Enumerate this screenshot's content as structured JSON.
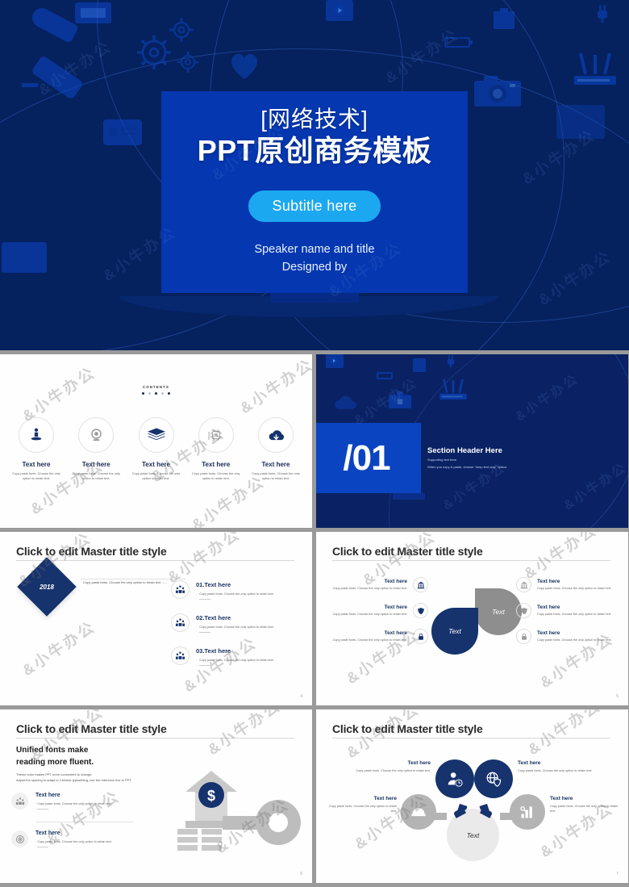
{
  "meta": {
    "watermark": "&小牛办公"
  },
  "colors": {
    "navy_dark": "#05215E",
    "blue_bright": "#0437B0",
    "accent_cyan": "#1CA8F0",
    "navy_text": "#17336E",
    "gray": "#8E8E8E"
  },
  "slides": [
    {
      "id": "title-slide",
      "pre_title": "[网络技术]",
      "title": "PPT原创商务模板",
      "subtitle_button": "Subtitle here",
      "speaker": "Speaker name and title",
      "designer": "Designed by"
    },
    {
      "id": "contents-slide",
      "label": "CONTENTS",
      "dots": 5,
      "items": [
        {
          "icon": "presenter-icon",
          "heading": "Text here",
          "body": "Copy paste fonts. Choose the only option to retain text.",
          "tone": "navy"
        },
        {
          "icon": "webcam-icon",
          "heading": "Text here",
          "body": "Copy paste fonts. Choose the only option to retain text.",
          "tone": "gray"
        },
        {
          "icon": "layers-icon",
          "heading": "Text here",
          "body": "Copy paste fonts. Choose the only option to retain text.",
          "tone": "navy"
        },
        {
          "icon": "chip-icon",
          "heading": "Text here",
          "body": "Copy paste fonts. Choose the only option to retain text.",
          "tone": "gray"
        },
        {
          "icon": "cloud-download-icon",
          "heading": "Text here",
          "body": "Copy paste fonts. Choose the only option to retain text.",
          "tone": "navy"
        }
      ]
    },
    {
      "id": "section-header-slide",
      "number": "/01",
      "heading": "Section Header Here",
      "sub1": "Supporting text here.",
      "sub2": "When you copy & paste, choose \"keep text only\" option."
    },
    {
      "id": "timeline-slide",
      "title": "Click to edit Master title style",
      "year": "2018",
      "note": "Copy paste fonts. Choose the only option to retain text……",
      "page": "4",
      "steps": [
        {
          "icon": "team-icon",
          "heading": "01.Text here",
          "body": "Copy paste fonts. Choose the only option to retain text."
        },
        {
          "icon": "team-icon",
          "heading": "02.Text here",
          "body": "Copy paste fonts. Choose the only option to retain text."
        },
        {
          "icon": "team-icon",
          "heading": "03.Text here",
          "body": "Copy paste fonts. Choose the only option to retain text."
        }
      ]
    },
    {
      "id": "leaf-diagram-slide",
      "title": "Click to edit Master title style",
      "page": "5",
      "center_navy": "Text",
      "center_gray": "Text",
      "left_items": [
        {
          "icon": "bank-icon",
          "heading": "Text here",
          "body": "Copy paste fonts. Choose the only option to retain text."
        },
        {
          "icon": "shield-icon",
          "heading": "Text here",
          "body": "Copy paste fonts. Choose the only option to retain text."
        },
        {
          "icon": "lock-icon",
          "heading": "Text here",
          "body": "Copy paste fonts. Choose the only option to retain text."
        }
      ],
      "right_items": [
        {
          "icon": "bank-icon",
          "heading": "Text here",
          "body": "Copy paste fonts. Choose the only option to retain text."
        },
        {
          "icon": "shield-icon",
          "heading": "Text here",
          "body": "Copy paste fonts. Choose the only option to retain text."
        },
        {
          "icon": "lock-icon",
          "heading": "Text here",
          "body": "Copy paste fonts. Choose the only option to retain text."
        }
      ]
    },
    {
      "id": "fonts-slide",
      "title": "Click to edit Master title style",
      "page": "6",
      "heading_line1": "Unified fonts make",
      "heading_line2": "reading more fluent.",
      "para1": "Theme color makes PPT more convenient to change.",
      "para2": "Adjust the spacing to adapt to Chinese typesetting, use the reference line in PPT.",
      "items": [
        {
          "icon": "team-icon",
          "heading": "Text here",
          "body": "Copy paste fonts. Choose the only option to retain text."
        },
        {
          "icon": "target-icon",
          "heading": "Text here",
          "body": "Copy paste fonts. Choose the only option to retain text."
        }
      ],
      "illustration": "house-key-dollar-icon"
    },
    {
      "id": "bubble-diagram-slide",
      "title": "Click to edit Master title style",
      "page": "7",
      "center": "Text",
      "bubbles": [
        {
          "icon": "user-clock-icon",
          "heading": "Text here",
          "body": "Copy paste fonts. Choose the only option to retain text.",
          "tone": "navy",
          "pos": "top-left"
        },
        {
          "icon": "globe-shield-icon",
          "heading": "Text here",
          "body": "Copy paste fonts. Choose the only option to retain text.",
          "tone": "navy",
          "pos": "top-right"
        },
        {
          "icon": "helmet-icon",
          "heading": "Text here",
          "body": "Copy paste fonts. Choose the only option to retain text.",
          "tone": "gray",
          "pos": "left"
        },
        {
          "icon": "bar-chart-icon",
          "heading": "Text here",
          "body": "Copy paste fonts. Choose the only option to retain text.",
          "tone": "gray",
          "pos": "right"
        }
      ]
    }
  ]
}
